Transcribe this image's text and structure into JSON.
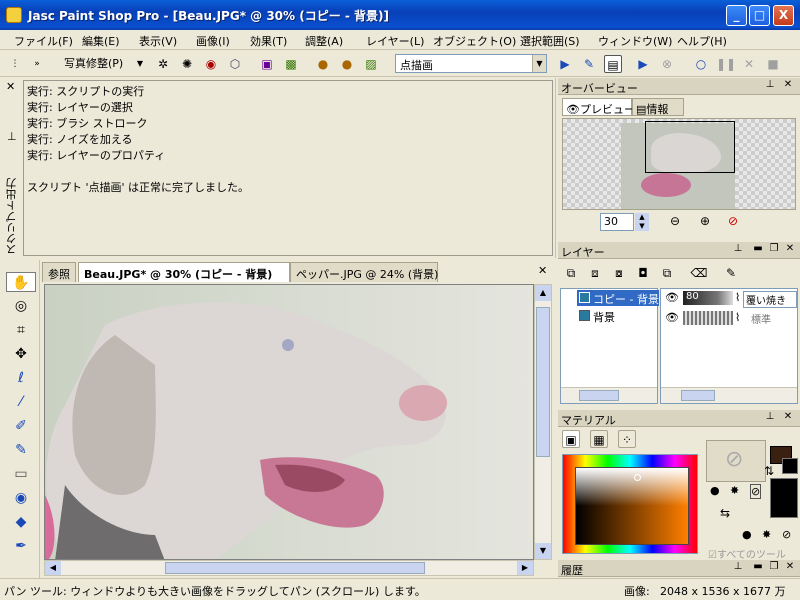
{
  "window": {
    "title": "Jasc Paint Shop Pro - [Beau.JPG* @  30% (コピー - 背景)]",
    "min_label": "_",
    "max_label": "□",
    "close_label": "X"
  },
  "menu": {
    "items": [
      "ファイル(F)",
      "編集(E)",
      "表示(V)",
      "画像(I)",
      "効果(T)",
      "調整(A)",
      "レイヤー(L)",
      "オブジェクト(O)",
      "選択範囲(S)",
      "ウィンドウ(W)",
      "ヘルプ(H)"
    ]
  },
  "toolbar": {
    "photo_menu": "写真修整(P)",
    "script_select": "点描画"
  },
  "script_output": {
    "side_label": "スクリプト出力",
    "lines": [
      "実行: スクリプトの実行",
      "実行: レイヤーの選択",
      "実行: ブラシ ストローク",
      "実行: ノイズを加える",
      "実行: レイヤーのプロパティ",
      "",
      "スクリプト '点描画' は正常に完了しました。"
    ]
  },
  "image_tabs": [
    "参照",
    "Beau.JPG* @  30% (コピー - 背景)",
    "ペッパー.JPG @  24% (背景)"
  ],
  "overview": {
    "title": "オーバービュー",
    "tab_preview": "プレビュー",
    "tab_info": "情報",
    "zoom_value": "30"
  },
  "layers": {
    "title": "レイヤー",
    "items": [
      {
        "name": "コピー - 背景",
        "opacity": "80",
        "blend": "覆い焼き"
      },
      {
        "name": "背景",
        "opacity": "",
        "blend": "標準"
      }
    ]
  },
  "materials": {
    "title": "マテリアル",
    "all_tools": "すべてのツール"
  },
  "history": {
    "title": "履歴"
  },
  "status": {
    "hint": "パン ツール: ウィンドウよりも大きい画像をドラッグしてパン (スクロール) します。",
    "image_label": "画像:",
    "image_info": "2048 x 1536 x 1677 万"
  },
  "colors": {
    "title_bar": "#0a4fd0",
    "layer_selected": "#316ac5",
    "foreground": "#3a2010",
    "background": "#000000"
  }
}
